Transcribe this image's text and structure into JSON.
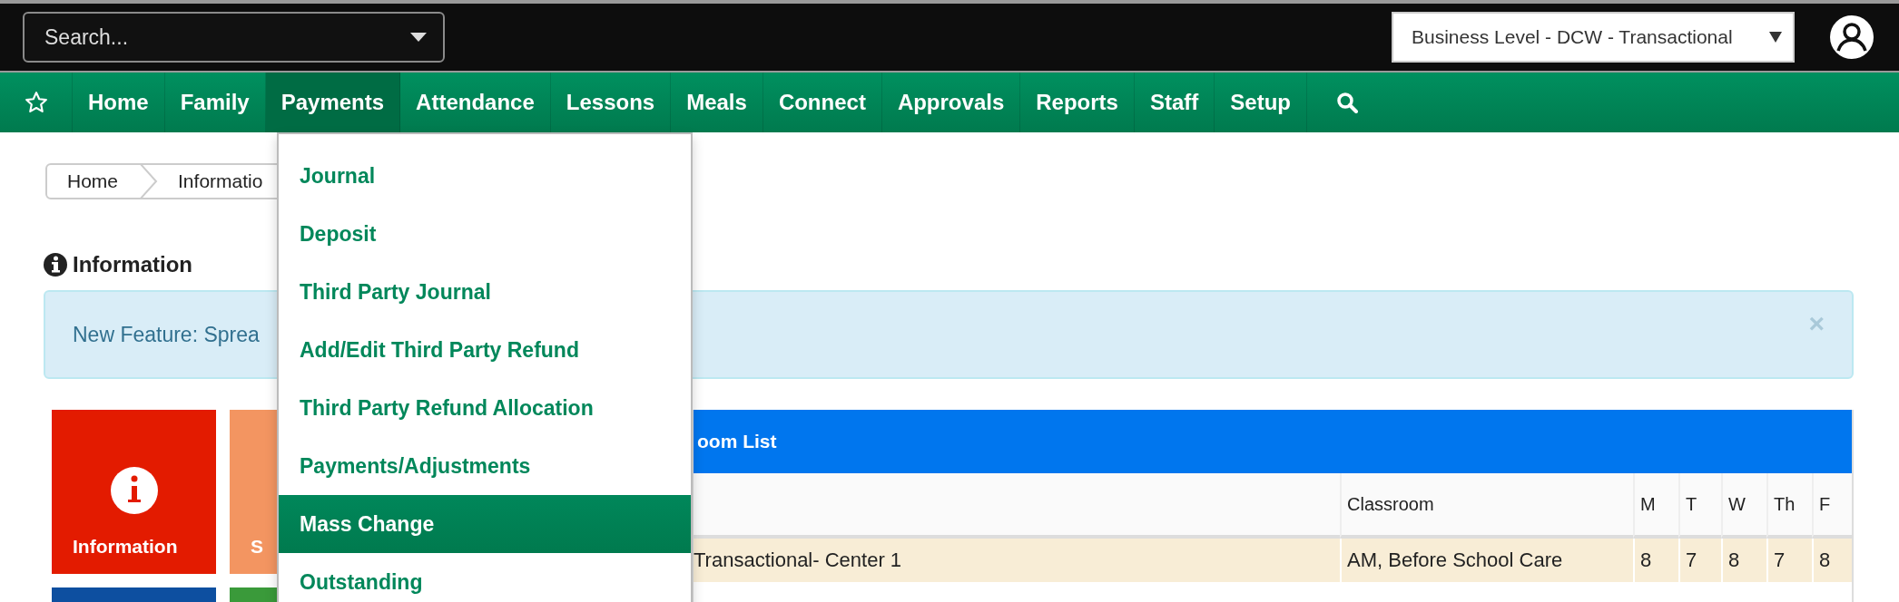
{
  "top_bar": {
    "search": {
      "placeholder": "Search..."
    },
    "business_select": {
      "value": "Business Level - DCW - Transactional"
    }
  },
  "nav": {
    "items": [
      {
        "label": "Home",
        "selected": false
      },
      {
        "label": "Family",
        "selected": false
      },
      {
        "label": "Payments",
        "selected": true
      },
      {
        "label": "Attendance",
        "selected": false
      },
      {
        "label": "Lessons",
        "selected": false
      },
      {
        "label": "Meals",
        "selected": false
      },
      {
        "label": "Connect",
        "selected": false
      },
      {
        "label": "Approvals",
        "selected": false
      },
      {
        "label": "Reports",
        "selected": false
      },
      {
        "label": "Staff",
        "selected": false
      },
      {
        "label": "Setup",
        "selected": false
      }
    ]
  },
  "payments_menu": {
    "items": [
      {
        "label": "Journal",
        "selected": false
      },
      {
        "label": "Deposit",
        "selected": false
      },
      {
        "label": "Third Party Journal",
        "selected": false
      },
      {
        "label": "Add/Edit Third Party Refund",
        "selected": false
      },
      {
        "label": "Third Party Refund Allocation",
        "selected": false
      },
      {
        "label": "Payments/Adjustments",
        "selected": false
      },
      {
        "label": "Mass Change",
        "selected": true
      },
      {
        "label": "Outstanding",
        "selected": false
      }
    ]
  },
  "breadcrumb": [
    "Home",
    "Informatio"
  ],
  "section_title": "Information",
  "alert": {
    "text": "New Feature: Sprea",
    "close": "×"
  },
  "tiles": [
    {
      "label": "Information",
      "color": "#e31b00"
    },
    {
      "label": "S",
      "color": "#f39561"
    },
    {
      "color": "#0d4fa0"
    },
    {
      "color": "#3a9a3a"
    }
  ],
  "table": {
    "title": "oom List",
    "columns": [
      "",
      "Classroom",
      "M",
      "T",
      "W",
      "Th",
      "F"
    ],
    "rows": [
      {
        "cells": [
          "Transactional- Center 1",
          "AM, Before School Care",
          "8",
          "7",
          "8",
          "7",
          "8"
        ]
      }
    ]
  }
}
